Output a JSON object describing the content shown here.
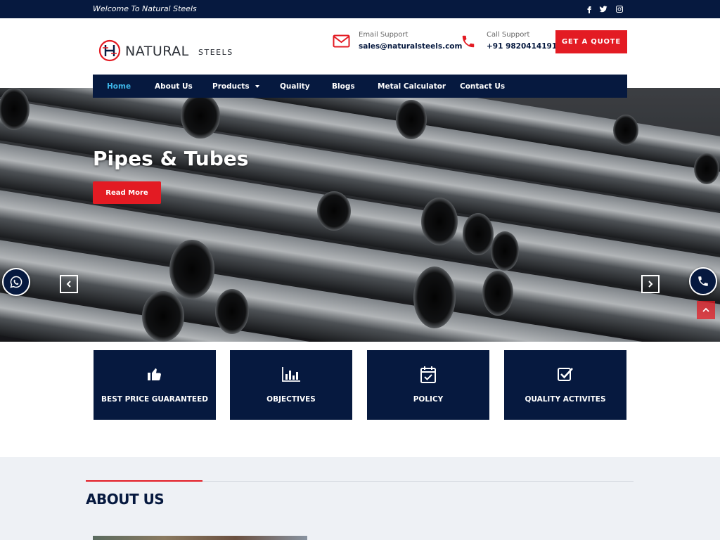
{
  "topbar": {
    "welcome": "Welcome To Natural Steels",
    "social": [
      "facebook-icon",
      "twitter-icon",
      "instagram-icon"
    ]
  },
  "header": {
    "logo_main": "NATURAL",
    "logo_sub": "STEELS",
    "email_label": "Email Support",
    "email_value": "sales@naturalsteels.com",
    "call_label": "Call Support",
    "call_value": "+91 9820414191",
    "quote_button": "GET A QUOTE"
  },
  "nav": {
    "items": [
      {
        "label": "Home",
        "active": true
      },
      {
        "label": "About Us"
      },
      {
        "label": "Products",
        "dropdown": true
      },
      {
        "label": "Quality"
      },
      {
        "label": "Blogs"
      },
      {
        "label": "Metal Calculator"
      },
      {
        "label": "Contact Us"
      }
    ]
  },
  "hero": {
    "title": "Pipes & Tubes",
    "button": "Read More"
  },
  "features": [
    {
      "label": "BEST PRICE GUARANTEED",
      "icon": "thumbs-up-icon"
    },
    {
      "label": "OBJECTIVES",
      "icon": "bar-chart-icon"
    },
    {
      "label": "POLICY",
      "icon": "calendar-check-icon"
    },
    {
      "label": "QUALITY ACTIVITES",
      "icon": "checkbox-icon"
    }
  ],
  "about": {
    "heading": "ABOUT US"
  },
  "colors": {
    "navy": "#06193f",
    "red": "#e31b23",
    "active_nav": "#3eb6e8"
  }
}
